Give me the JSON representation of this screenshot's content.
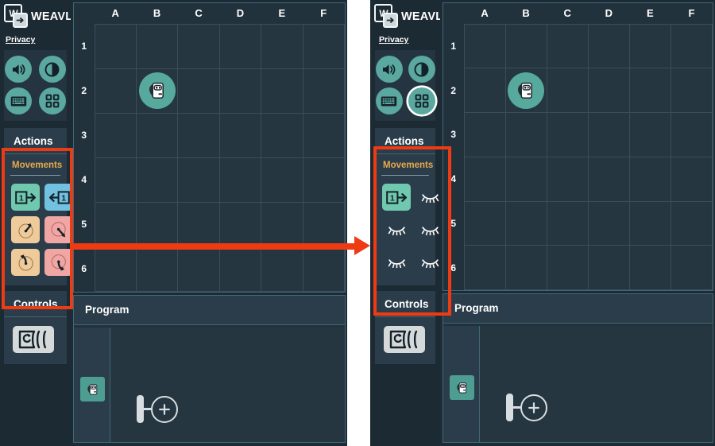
{
  "brand": {
    "name": "WEAVLY",
    "logo_letter": "W",
    "logo_icon": "arrow-right-icon"
  },
  "privacy_link": "Privacy",
  "toolbar": {
    "buttons": [
      {
        "name": "volume-icon",
        "label": "Sound",
        "selected": false
      },
      {
        "name": "contrast-icon",
        "label": "Contrast",
        "selected": false
      },
      {
        "name": "keyboard-icon",
        "label": "Keyboard",
        "selected": false
      },
      {
        "name": "apps-grid-icon",
        "label": "Action menu",
        "selected": true
      }
    ]
  },
  "actions_panel": {
    "title": "Actions",
    "group_label": "Movements",
    "tiles_left": [
      {
        "icon": "forward-one-icon",
        "label": "Forward 1",
        "color": "green",
        "hidden": false
      },
      {
        "icon": "backward-one-icon",
        "label": "Backward 1",
        "color": "blue",
        "hidden": false
      },
      {
        "icon": "turn-left-45-icon",
        "label": "Turn left 45",
        "color": "tan",
        "hidden": false
      },
      {
        "icon": "turn-right-45-icon",
        "label": "Turn right 45",
        "color": "pink",
        "hidden": false
      },
      {
        "icon": "turn-left-90-icon",
        "label": "Turn left 90",
        "color": "tan",
        "hidden": false
      },
      {
        "icon": "turn-right-90-icon",
        "label": "Turn right 90",
        "color": "pink",
        "hidden": false
      }
    ],
    "tiles_right": [
      {
        "icon": "forward-one-icon",
        "label": "Forward 1",
        "color": "green",
        "hidden": false
      },
      {
        "icon": "eye-closed-icon",
        "label": "Hidden",
        "color": "none",
        "hidden": true
      },
      {
        "icon": "eye-closed-icon",
        "label": "Hidden",
        "color": "none",
        "hidden": true
      },
      {
        "icon": "eye-closed-icon",
        "label": "Hidden",
        "color": "none",
        "hidden": true
      },
      {
        "icon": "eye-closed-icon",
        "label": "Hidden",
        "color": "none",
        "hidden": true
      },
      {
        "icon": "eye-closed-icon",
        "label": "Hidden",
        "color": "none",
        "hidden": true
      }
    ]
  },
  "controls_panel": {
    "title": "Controls",
    "tiles": [
      {
        "icon": "loop-icon",
        "label": "Loop"
      }
    ]
  },
  "world": {
    "columns": [
      "A",
      "B",
      "C",
      "D",
      "E",
      "F"
    ],
    "rows": [
      "1",
      "2",
      "3",
      "4",
      "5",
      "6"
    ],
    "character": {
      "icon": "robot-icon",
      "cell": "B2"
    }
  },
  "program_panel": {
    "title": "Program",
    "rail_item": {
      "icon": "robot-icon",
      "label": "Character"
    },
    "add_node": {
      "icon": "plus-icon",
      "label": "Add action to program"
    }
  },
  "annotations": {
    "left_highlight": "Actions movements panel — all six tiles visible",
    "right_highlight": "Actions movements panel — only Forward 1 visible, others hidden",
    "arrow": "arrow-right-annotation",
    "color": "#ef3b13"
  },
  "palette": {
    "accent_teal": "#5aa89f",
    "panel_bg": "#2b3d4a",
    "app_bg": "#1e2b36",
    "grid_cell": "#253641",
    "group_label": "#e9a84c",
    "tile_green": "#70c9ae",
    "tile_blue": "#72c1e0",
    "tile_tan": "#efcb9b",
    "tile_pink": "#f0a6a2",
    "annotation_red": "#ef3b13"
  }
}
